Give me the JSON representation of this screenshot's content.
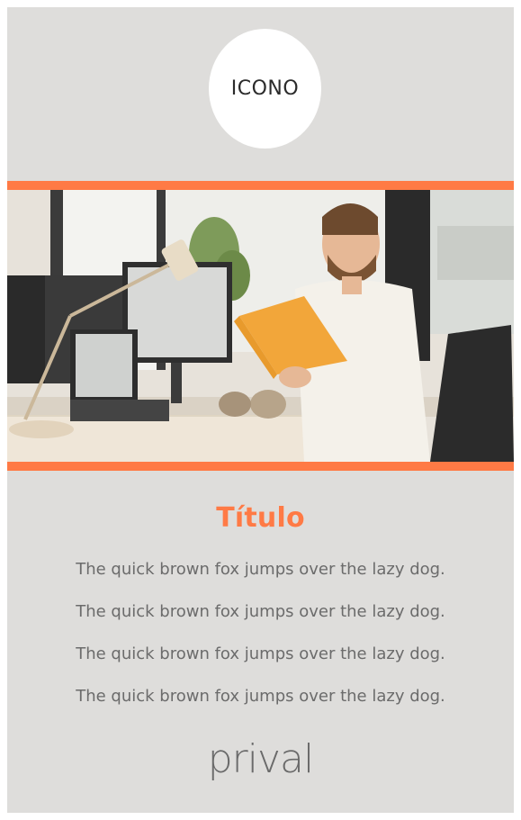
{
  "icon": {
    "label": "ICONO"
  },
  "colors": {
    "accent": "#ff7a45",
    "background": "#dedddb",
    "text": "#6b6b6b"
  },
  "photo": {
    "description_icon": "office-photo"
  },
  "content": {
    "title": "Título",
    "lines": [
      "The quick brown fox jumps over the lazy dog.",
      "The quick brown fox jumps over the lazy dog.",
      "The quick brown fox jumps over the lazy dog.",
      "The quick brown fox jumps over the lazy dog."
    ]
  },
  "brand": {
    "logo_text": "prival"
  }
}
